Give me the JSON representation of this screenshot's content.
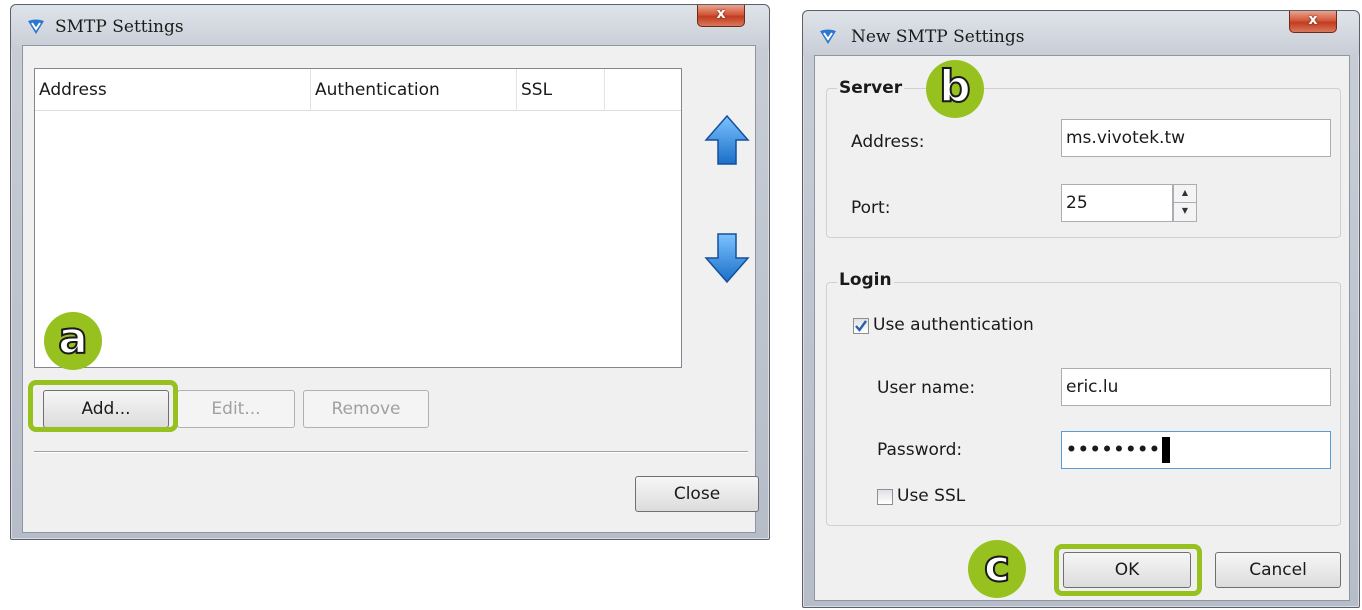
{
  "smtp_window": {
    "title": "SMTP Settings",
    "close_glyph": "x",
    "table_headers": [
      "Address",
      "Authentication",
      "SSL"
    ],
    "rows": [],
    "buttons": {
      "add": "Add...",
      "edit": "Edit...",
      "remove": "Remove",
      "close": "Close"
    },
    "icons": {
      "move_up": "arrow-up-icon",
      "move_down": "arrow-down-icon"
    }
  },
  "new_smtp_window": {
    "title": "New SMTP Settings",
    "close_glyph": "x",
    "server_group": {
      "title": "Server",
      "address_label": "Address:",
      "address_value": "ms.vivotek.tw",
      "port_label": "Port:",
      "port_value": "25"
    },
    "login_group": {
      "title": "Login",
      "use_auth_label": "Use authentication",
      "use_auth_checked": true,
      "username_label": "User name:",
      "username_value": "eric.lu",
      "password_label": "Password:",
      "password_value": "••••••••",
      "use_ssl_label": "Use SSL",
      "use_ssl_checked": false
    },
    "buttons": {
      "ok": "OK",
      "cancel": "Cancel"
    }
  },
  "annotations": {
    "a": "a",
    "b": "b",
    "c": "c"
  },
  "colors": {
    "annotation_green": "#96c11f",
    "close_red": "#c23d20",
    "arrow_blue": "#2f86d8"
  }
}
